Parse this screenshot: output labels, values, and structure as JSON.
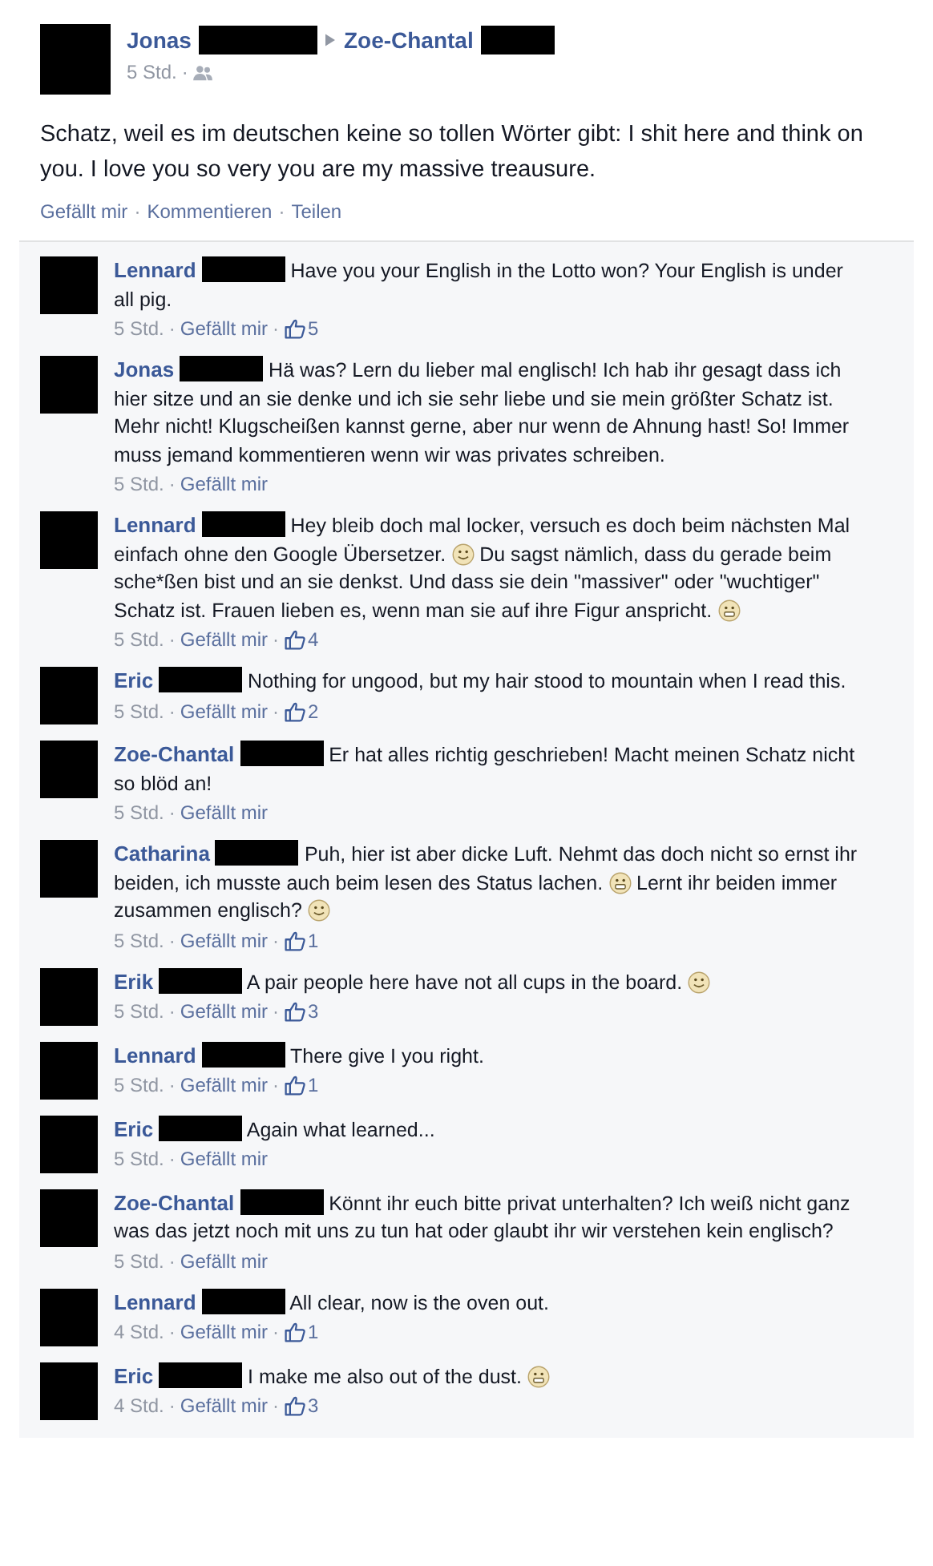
{
  "post": {
    "author": "Jonas",
    "recipient": "Zoe-Chantal",
    "meta": [
      {
        "kind": "time",
        "text": "5 Std."
      },
      {
        "kind": "sep",
        "text": "·"
      },
      {
        "kind": "audience"
      }
    ],
    "text": "Schatz, weil es im deutschen keine so tollen Wörter gibt: I shit here and think on you. I love you so very you are my massive treausure.",
    "actions": [
      {
        "kind": "link",
        "text": "Gefällt mir"
      },
      {
        "kind": "sep",
        "text": "·"
      },
      {
        "kind": "link",
        "text": "Kommentieren"
      },
      {
        "kind": "sep",
        "text": "·"
      },
      {
        "kind": "link",
        "text": "Teilen"
      }
    ]
  },
  "comments": [
    {
      "author": "Lennard",
      "parts": [
        {
          "kind": "text",
          "text": "Have you your English in the Lotto won? Your English is under all pig."
        }
      ],
      "meta": [
        {
          "kind": "time",
          "text": "5 Std."
        },
        {
          "kind": "sep",
          "text": "·"
        },
        {
          "kind": "link",
          "text": "Gefällt mir"
        },
        {
          "kind": "sep",
          "text": "·"
        },
        {
          "kind": "likes",
          "text": "5"
        }
      ]
    },
    {
      "author": "Jonas",
      "parts": [
        {
          "kind": "text",
          "text": "Hä was? Lern du lieber mal englisch! Ich hab ihr gesagt dass ich hier sitze und an sie denke und ich sie sehr liebe und sie mein größter Schatz ist. Mehr nicht! Klugscheißen kannst gerne, aber nur wenn de Ahnung hast! So! Immer muss jemand kommentieren wenn wir was privates schreiben."
        }
      ],
      "meta": [
        {
          "kind": "time",
          "text": "5 Std."
        },
        {
          "kind": "sep",
          "text": "·"
        },
        {
          "kind": "link",
          "text": "Gefällt mir"
        }
      ]
    },
    {
      "author": "Lennard",
      "parts": [
        {
          "kind": "text",
          "text": "Hey bleib doch mal locker, versuch es doch beim nächsten Mal einfach ohne den Google Übersetzer."
        },
        {
          "kind": "smile"
        },
        {
          "kind": "text",
          "text": "Du sagst nämlich, dass du gerade beim sche*ßen bist und an sie denkst. Und dass sie dein \"massiver\" oder \"wuchtiger\" Schatz ist. Frauen lieben es, wenn man sie auf ihre Figur anspricht."
        },
        {
          "kind": "grin"
        }
      ],
      "meta": [
        {
          "kind": "time",
          "text": "5 Std."
        },
        {
          "kind": "sep",
          "text": "·"
        },
        {
          "kind": "link",
          "text": "Gefällt mir"
        },
        {
          "kind": "sep",
          "text": "·"
        },
        {
          "kind": "likes",
          "text": "4"
        }
      ]
    },
    {
      "author": "Eric",
      "parts": [
        {
          "kind": "text",
          "text": "Nothing for ungood, but my hair stood to mountain when I read this."
        }
      ],
      "meta": [
        {
          "kind": "time",
          "text": "5 Std."
        },
        {
          "kind": "sep",
          "text": "·"
        },
        {
          "kind": "link",
          "text": "Gefällt mir"
        },
        {
          "kind": "sep",
          "text": "·"
        },
        {
          "kind": "likes",
          "text": "2"
        }
      ]
    },
    {
      "author": "Zoe-Chantal",
      "parts": [
        {
          "kind": "text",
          "text": "Er hat alles richtig geschrieben! Macht meinen Schatz nicht so blöd an!"
        }
      ],
      "meta": [
        {
          "kind": "time",
          "text": "5 Std."
        },
        {
          "kind": "sep",
          "text": "·"
        },
        {
          "kind": "link",
          "text": "Gefällt mir"
        }
      ]
    },
    {
      "author": "Catharina",
      "parts": [
        {
          "kind": "text",
          "text": "Puh, hier ist aber dicke Luft. Nehmt das doch nicht so ernst ihr beiden, ich musste auch beim lesen des Status lachen."
        },
        {
          "kind": "grin"
        },
        {
          "kind": "text",
          "text": "Lernt ihr beiden immer zusammen englisch?"
        },
        {
          "kind": "smile"
        }
      ],
      "meta": [
        {
          "kind": "time",
          "text": "5 Std."
        },
        {
          "kind": "sep",
          "text": "·"
        },
        {
          "kind": "link",
          "text": "Gefällt mir"
        },
        {
          "kind": "sep",
          "text": "·"
        },
        {
          "kind": "likes",
          "text": "1"
        }
      ]
    },
    {
      "author": "Erik",
      "parts": [
        {
          "kind": "text",
          "text": "A pair people here have not all cups in the board."
        },
        {
          "kind": "smile"
        }
      ],
      "meta": [
        {
          "kind": "time",
          "text": "5 Std."
        },
        {
          "kind": "sep",
          "text": "·"
        },
        {
          "kind": "link",
          "text": "Gefällt mir"
        },
        {
          "kind": "sep",
          "text": "·"
        },
        {
          "kind": "likes",
          "text": "3"
        }
      ]
    },
    {
      "author": "Lennard",
      "parts": [
        {
          "kind": "text",
          "text": "There give I you right."
        }
      ],
      "meta": [
        {
          "kind": "time",
          "text": "5 Std."
        },
        {
          "kind": "sep",
          "text": "·"
        },
        {
          "kind": "link",
          "text": "Gefällt mir"
        },
        {
          "kind": "sep",
          "text": "·"
        },
        {
          "kind": "likes",
          "text": "1"
        }
      ]
    },
    {
      "author": "Eric",
      "parts": [
        {
          "kind": "text",
          "text": "Again what learned..."
        }
      ],
      "meta": [
        {
          "kind": "time",
          "text": "5 Std."
        },
        {
          "kind": "sep",
          "text": "·"
        },
        {
          "kind": "link",
          "text": "Gefällt mir"
        }
      ]
    },
    {
      "author": "Zoe-Chantal",
      "parts": [
        {
          "kind": "text",
          "text": "Könnt ihr euch bitte privat unterhalten? Ich weiß nicht ganz was das jetzt noch mit uns zu tun hat oder glaubt ihr wir verstehen kein englisch?"
        }
      ],
      "meta": [
        {
          "kind": "time",
          "text": "5 Std."
        },
        {
          "kind": "sep",
          "text": "·"
        },
        {
          "kind": "link",
          "text": "Gefällt mir"
        }
      ]
    },
    {
      "author": "Lennard",
      "parts": [
        {
          "kind": "text",
          "text": "All clear, now is the oven out."
        }
      ],
      "meta": [
        {
          "kind": "time",
          "text": "4 Std."
        },
        {
          "kind": "sep",
          "text": "·"
        },
        {
          "kind": "link",
          "text": "Gefällt mir"
        },
        {
          "kind": "sep",
          "text": "·"
        },
        {
          "kind": "likes",
          "text": "1"
        }
      ]
    },
    {
      "author": "Eric",
      "parts": [
        {
          "kind": "text",
          "text": "I make me also out of the dust."
        },
        {
          "kind": "grin"
        }
      ],
      "meta": [
        {
          "kind": "time",
          "text": "4 Std."
        },
        {
          "kind": "sep",
          "text": "·"
        },
        {
          "kind": "link",
          "text": "Gefällt mir"
        },
        {
          "kind": "sep",
          "text": "·"
        },
        {
          "kind": "likes",
          "text": "3"
        }
      ]
    }
  ]
}
